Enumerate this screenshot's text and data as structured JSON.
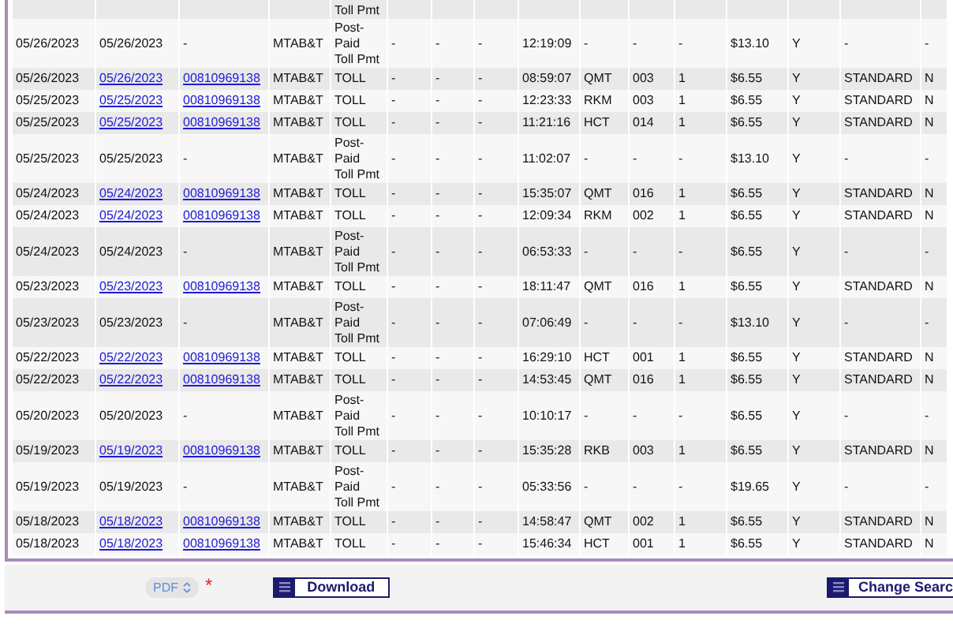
{
  "table": {
    "rows": [
      {
        "kind": "partial",
        "cells": [
          "",
          "",
          "",
          "",
          "Toll Pmt",
          "",
          "",
          "",
          "",
          "",
          "",
          "",
          "",
          "",
          "",
          ""
        ]
      },
      {
        "kind": "postpaid",
        "cells": [
          "05/26/2023",
          "05/26/2023",
          "-",
          "MTAB&T",
          "Post-Paid Toll Pmt",
          "-",
          "-",
          "-",
          "12:19:09",
          "-",
          "-",
          "-",
          "$13.10",
          "Y",
          "-",
          "-"
        ]
      },
      {
        "kind": "toll",
        "cells": [
          "05/26/2023",
          "05/26/2023",
          "00810969138",
          "MTAB&T",
          "TOLL",
          "-",
          "-",
          "-",
          "08:59:07",
          "QMT",
          "003",
          "1",
          "$6.55",
          "Y",
          "STANDARD",
          "N"
        ]
      },
      {
        "kind": "toll",
        "cells": [
          "05/25/2023",
          "05/25/2023",
          "00810969138",
          "MTAB&T",
          "TOLL",
          "-",
          "-",
          "-",
          "12:23:33",
          "RKM",
          "003",
          "1",
          "$6.55",
          "Y",
          "STANDARD",
          "N"
        ]
      },
      {
        "kind": "toll",
        "cells": [
          "05/25/2023",
          "05/25/2023",
          "00810969138",
          "MTAB&T",
          "TOLL",
          "-",
          "-",
          "-",
          "11:21:16",
          "HCT",
          "014",
          "1",
          "$6.55",
          "Y",
          "STANDARD",
          "N"
        ]
      },
      {
        "kind": "postpaid",
        "cells": [
          "05/25/2023",
          "05/25/2023",
          "-",
          "MTAB&T",
          "Post-Paid Toll Pmt",
          "-",
          "-",
          "-",
          "11:02:07",
          "-",
          "-",
          "-",
          "$13.10",
          "Y",
          "-",
          "-"
        ]
      },
      {
        "kind": "toll",
        "cells": [
          "05/24/2023",
          "05/24/2023",
          "00810969138",
          "MTAB&T",
          "TOLL",
          "-",
          "-",
          "-",
          "15:35:07",
          "QMT",
          "016",
          "1",
          "$6.55",
          "Y",
          "STANDARD",
          "N"
        ]
      },
      {
        "kind": "toll",
        "cells": [
          "05/24/2023",
          "05/24/2023",
          "00810969138",
          "MTAB&T",
          "TOLL",
          "-",
          "-",
          "-",
          "12:09:34",
          "RKM",
          "002",
          "1",
          "$6.55",
          "Y",
          "STANDARD",
          "N"
        ]
      },
      {
        "kind": "postpaid",
        "cells": [
          "05/24/2023",
          "05/24/2023",
          "-",
          "MTAB&T",
          "Post-Paid Toll Pmt",
          "-",
          "-",
          "-",
          "06:53:33",
          "-",
          "-",
          "-",
          "$6.55",
          "Y",
          "-",
          "-"
        ]
      },
      {
        "kind": "toll",
        "cells": [
          "05/23/2023",
          "05/23/2023",
          "00810969138",
          "MTAB&T",
          "TOLL",
          "-",
          "-",
          "-",
          "18:11:47",
          "QMT",
          "016",
          "1",
          "$6.55",
          "Y",
          "STANDARD",
          "N"
        ]
      },
      {
        "kind": "postpaid",
        "cells": [
          "05/23/2023",
          "05/23/2023",
          "-",
          "MTAB&T",
          "Post-Paid Toll Pmt",
          "-",
          "-",
          "-",
          "07:06:49",
          "-",
          "-",
          "-",
          "$13.10",
          "Y",
          "-",
          "-"
        ]
      },
      {
        "kind": "toll",
        "cells": [
          "05/22/2023",
          "05/22/2023",
          "00810969138",
          "MTAB&T",
          "TOLL",
          "-",
          "-",
          "-",
          "16:29:10",
          "HCT",
          "001",
          "1",
          "$6.55",
          "Y",
          "STANDARD",
          "N"
        ]
      },
      {
        "kind": "toll",
        "cells": [
          "05/22/2023",
          "05/22/2023",
          "00810969138",
          "MTAB&T",
          "TOLL",
          "-",
          "-",
          "-",
          "14:53:45",
          "QMT",
          "016",
          "1",
          "$6.55",
          "Y",
          "STANDARD",
          "N"
        ]
      },
      {
        "kind": "postpaid",
        "cells": [
          "05/20/2023",
          "05/20/2023",
          "-",
          "MTAB&T",
          "Post-Paid Toll Pmt",
          "-",
          "-",
          "-",
          "10:10:17",
          "-",
          "-",
          "-",
          "$6.55",
          "Y",
          "-",
          "-"
        ]
      },
      {
        "kind": "toll",
        "cells": [
          "05/19/2023",
          "05/19/2023",
          "00810969138",
          "MTAB&T",
          "TOLL",
          "-",
          "-",
          "-",
          "15:35:28",
          "RKB",
          "003",
          "1",
          "$6.55",
          "Y",
          "STANDARD",
          "N"
        ]
      },
      {
        "kind": "postpaid",
        "cells": [
          "05/19/2023",
          "05/19/2023",
          "-",
          "MTAB&T",
          "Post-Paid Toll Pmt",
          "-",
          "-",
          "-",
          "05:33:56",
          "-",
          "-",
          "-",
          "$19.65",
          "Y",
          "-",
          "-"
        ]
      },
      {
        "kind": "toll",
        "cells": [
          "05/18/2023",
          "05/18/2023",
          "00810969138",
          "MTAB&T",
          "TOLL",
          "-",
          "-",
          "-",
          "14:58:47",
          "QMT",
          "002",
          "1",
          "$6.55",
          "Y",
          "STANDARD",
          "N"
        ]
      },
      {
        "kind": "toll",
        "cells": [
          "05/18/2023",
          "05/18/2023",
          "00810969138",
          "MTAB&T",
          "TOLL",
          "-",
          "-",
          "-",
          "15:46:34",
          "HCT",
          "001",
          "1",
          "$6.55",
          "Y",
          "STANDARD",
          "N"
        ]
      }
    ]
  },
  "footer": {
    "format_select": "PDF",
    "required_mark": "*",
    "download_button": "Download",
    "change_search_button": "Change Searc"
  }
}
